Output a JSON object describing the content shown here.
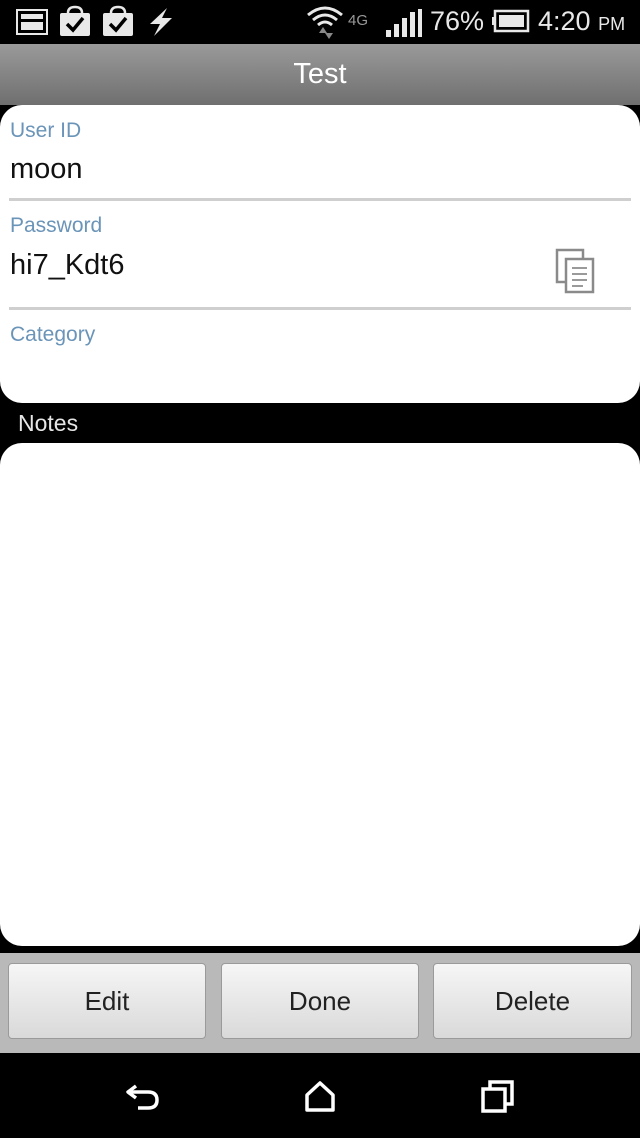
{
  "status_bar": {
    "battery_percent": "76%",
    "network": "4G",
    "time": "4:20",
    "time_suffix": "PM",
    "battery_level": 0.76
  },
  "title_bar": {
    "title": "Test"
  },
  "fields": {
    "user_id_label": "User ID",
    "user_id_value": "moon",
    "password_label": "Password",
    "password_value": "hi7_Kdt6",
    "category_label": "Category",
    "category_value": ""
  },
  "notes": {
    "label": "Notes",
    "value": ""
  },
  "actions": {
    "edit_label": "Edit",
    "done_label": "Done",
    "delete_label": "Delete"
  },
  "icons": {
    "copy": "copy-icon",
    "back": "back-icon",
    "home": "home-icon",
    "recents": "recents-icon"
  }
}
